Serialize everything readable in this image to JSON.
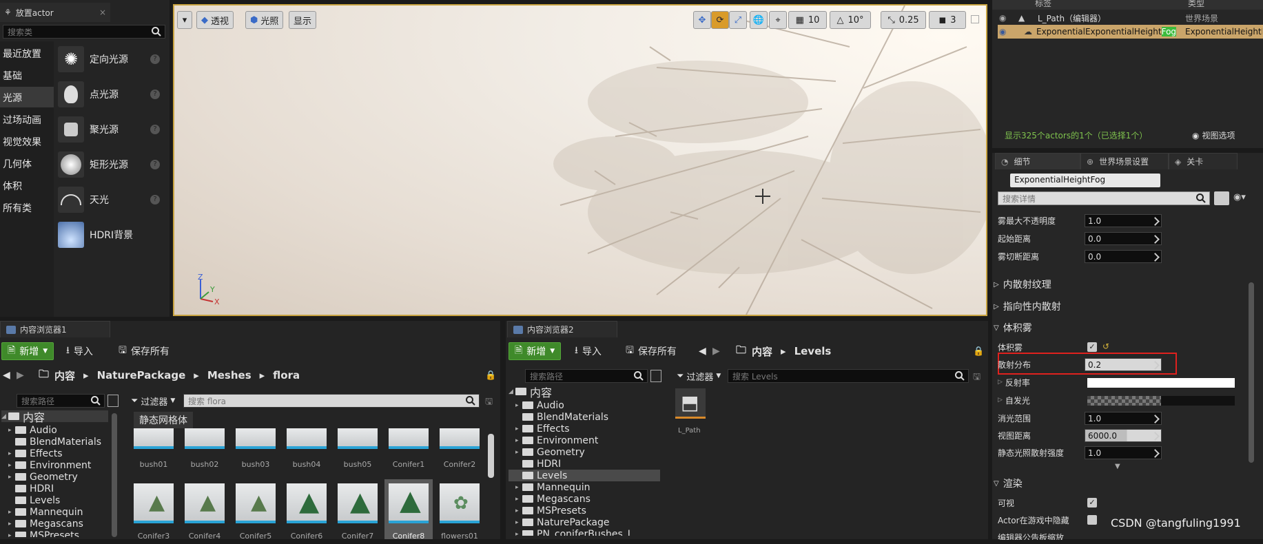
{
  "place_actors": {
    "tab_title": "放置actor",
    "search_placeholder": "搜索类",
    "categories": [
      "最近放置",
      "基础",
      "光源",
      "过场动画",
      "视觉效果",
      "几何体",
      "体积",
      "所有类"
    ],
    "items": [
      "定向光源",
      "点光源",
      "聚光源",
      "矩形光源",
      "天光",
      "HDRI背景"
    ]
  },
  "viewport": {
    "perspective": "透视",
    "lit": "光照",
    "show": "显示",
    "grid": "10",
    "angle": "10°",
    "scale": "0.25",
    "camera_speed": "3"
  },
  "outliner": {
    "col_label": "标签",
    "col_type": "类型",
    "rows": [
      {
        "label": "L_Path（编辑器）",
        "type": "世界场景"
      },
      {
        "label_prefix": "ExponentialExponentialHeight",
        "label_highlight": "Fog",
        "type": "ExponentialHeightFog"
      }
    ],
    "status": "显示325个actors的1个（已选择1个）",
    "view_options": "视图选项"
  },
  "details": {
    "tabs": [
      "细节",
      "世界场景设置",
      "关卡"
    ],
    "object_name": "ExponentialHeightFog",
    "search_placeholder": "搜索详情",
    "props_top": [
      {
        "label": "雾最大不透明度",
        "value": "1.0"
      },
      {
        "label": "起始距离",
        "value": "0.0"
      },
      {
        "label": "雾切断距离",
        "value": "0.0"
      }
    ],
    "sections": [
      "内散射纹理",
      "指向性内散射",
      "体积雾",
      "渲染"
    ],
    "volumetric_fog": "体积雾",
    "scattering": {
      "label": "散射分布",
      "value": "0.2"
    },
    "albedo": "反射率",
    "emissive": "自发光",
    "props_bottom": [
      {
        "label": "消光范围",
        "value": "1.0"
      },
      {
        "label": "视图距离",
        "value": "6000.0"
      },
      {
        "label": "静态光照散射强度",
        "value": "1.0"
      }
    ],
    "visible": "可视",
    "hidden_in_game": "Actor在游戏中隐藏",
    "last_row": "编辑器公告板缩放"
  },
  "cb1": {
    "tab_title": "内容浏览器1",
    "add_new": "新增",
    "import": "导入",
    "save_all": "保存所有",
    "path": [
      "内容",
      "NaturePackage",
      "Meshes",
      "flora"
    ],
    "search_paths": "搜索路径",
    "filters": "过滤器",
    "search_assets": "搜索 flora",
    "filter_chip": "静态网格体",
    "tree": [
      "内容",
      "Audio",
      "BlendMaterials",
      "Effects",
      "Environment",
      "Geometry",
      "HDRI",
      "Levels",
      "Mannequin",
      "Megascans",
      "MSPresets"
    ],
    "row1": [
      "bush01",
      "bush02",
      "bush03",
      "bush04",
      "bush05",
      "Conifer1",
      "Conifer2"
    ],
    "row2": [
      "Conifer3",
      "Conifer4",
      "Conifer5",
      "Conifer6",
      "Conifer7",
      "Conifer8",
      "flowers01"
    ]
  },
  "cb2": {
    "tab_title": "内容浏览器2",
    "add_new": "新增",
    "import": "导入",
    "save_all": "保存所有",
    "path": [
      "内容",
      "Levels"
    ],
    "search_paths": "搜索路径",
    "filters": "过滤器",
    "search_assets": "搜索 Levels",
    "tree": [
      "内容",
      "Audio",
      "BlendMaterials",
      "Effects",
      "Environment",
      "Geometry",
      "HDRI",
      "Levels",
      "Mannequin",
      "Megascans",
      "MSPresets",
      "NaturePackage",
      "PN_coniferBushes_I"
    ],
    "asset": "L_Path"
  },
  "watermark": "CSDN @tangfuling1991"
}
